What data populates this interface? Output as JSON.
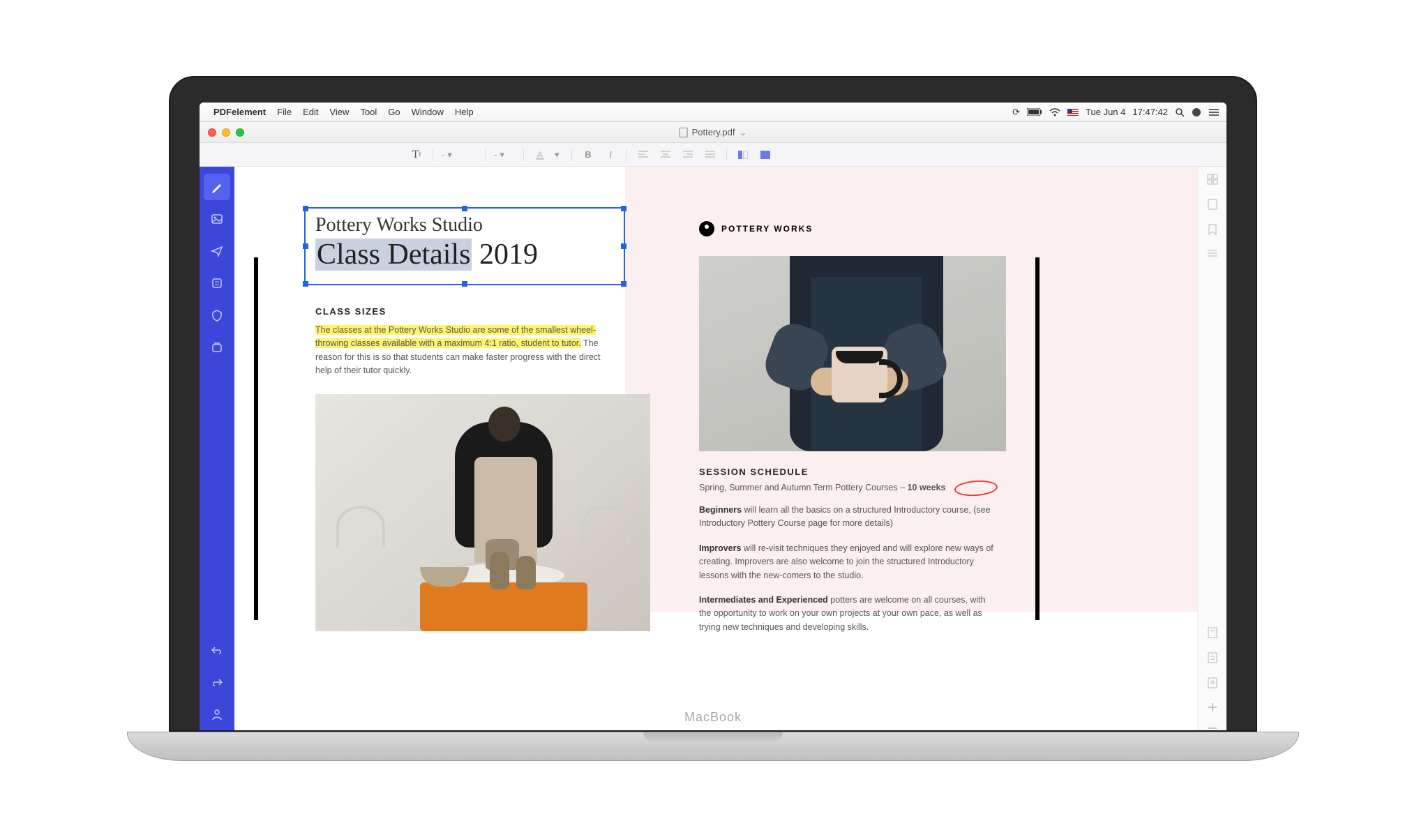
{
  "menubar": {
    "app_name": "PDFelement",
    "items": [
      "File",
      "Edit",
      "View",
      "Tool",
      "Go",
      "Window",
      "Help"
    ],
    "date": "Tue Jun 4",
    "time": "17:47:42"
  },
  "titlebar": {
    "document": "Pottery.pdf"
  },
  "toolbar": {
    "font_placeholder": "-",
    "size_placeholder": "-"
  },
  "document": {
    "subtitle": "Pottery Works Studio",
    "title_highlighted": "Class Details",
    "title_rest": " 2019",
    "brand": "POTTERY WORKS",
    "class_sizes": {
      "heading": "CLASS SIZES",
      "highlighted": "The classes at the Pottery Works Studio are some of the smallest wheel-throwing classes available with a maximum 4:1 ratio, student to tutor.",
      "rest": " The reason for this is so that students can make faster progress with the direct help of their tutor quickly."
    },
    "schedule": {
      "heading": "SESSION SCHEDULE",
      "line": "Spring, Summer and Autumn Term Pottery Courses –",
      "circled": "10 weeks",
      "beginners_b": "Beginners",
      "beginners": " will learn all the basics on a structured Introductory course, (see Introductory Pottery Course page for more details)",
      "improvers_b": "Improvers",
      "improvers": " will re-visit techniques they enjoyed and will explore new ways of creating. Improvers are also welcome to join the structured Introductory lessons with the new-comers to the studio.",
      "inter_b": "Intermediates and Experienced",
      "inter": " potters are welcome on all courses, with the opportunity to work on your own projects at your own pace, as well as trying new techniques and developing skills."
    }
  },
  "laptop_label": "MacBook"
}
